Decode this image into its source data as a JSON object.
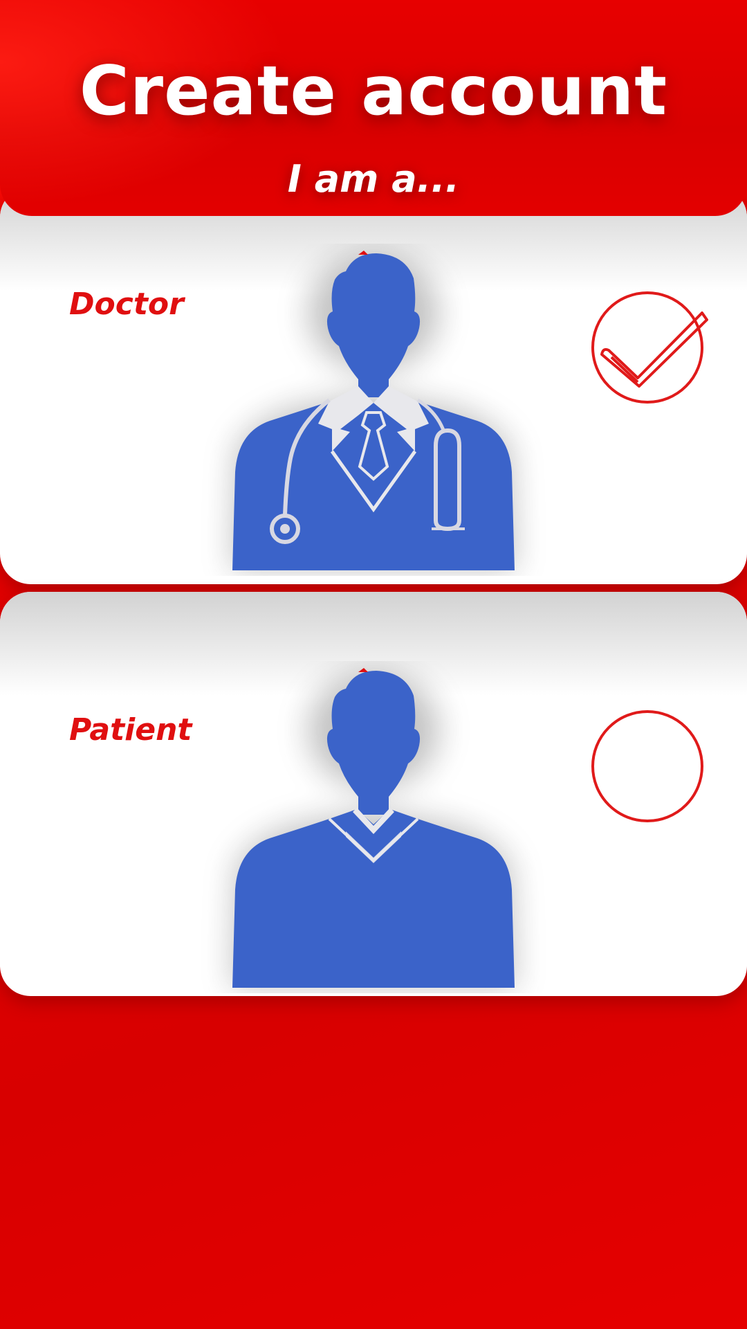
{
  "header": {
    "title": "Create account",
    "subtitle": "I am a..."
  },
  "roles": [
    {
      "label": "Doctor",
      "selected": true,
      "icon": "doctor-avatar-icon"
    },
    {
      "label": "Patient",
      "selected": false,
      "icon": "patient-avatar-icon"
    }
  ],
  "colors": {
    "background_red": "#e00000",
    "accent_red": "#e00f10",
    "avatar_blue": "#3b63c9",
    "card_white": "#ffffff"
  }
}
